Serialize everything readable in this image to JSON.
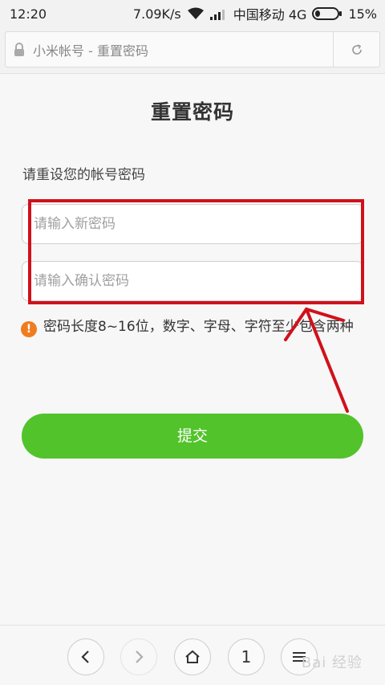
{
  "status_bar": {
    "time": "12:20",
    "speed": "7.09K/s",
    "carrier": "中国移动 4G",
    "battery": "15%"
  },
  "address_bar": {
    "url": "小米帐号 - 重置密码"
  },
  "page": {
    "title": "重置密码",
    "subtitle": "请重设您的帐号密码",
    "new_password_placeholder": "请输入新密码",
    "confirm_password_placeholder": "请输入确认密码",
    "hint": "密码长度8~16位，数字、字母、字符至少包含两种",
    "hint_icon": "!",
    "submit_label": "提交"
  },
  "bottom_nav": {
    "tabs_count": "1",
    "watermark": "Bai 经验"
  },
  "colors": {
    "accent_green": "#52c32b",
    "warning_orange": "#f07c20",
    "annotation_red": "#d0111b"
  }
}
